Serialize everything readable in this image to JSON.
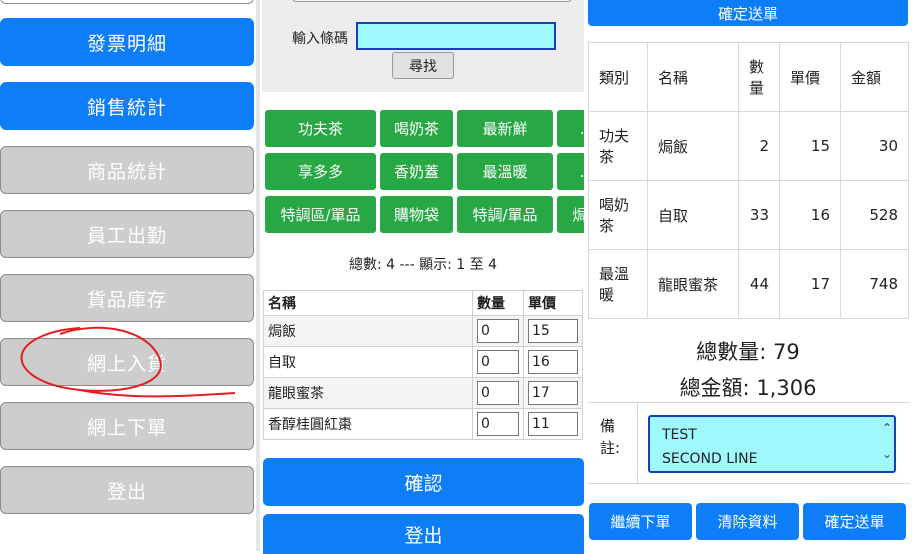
{
  "nav": {
    "items": [
      {
        "label": "發票明細",
        "active": true
      },
      {
        "label": "銷售統計",
        "active": true
      },
      {
        "label": "商品統計",
        "active": false
      },
      {
        "label": "員工出勤",
        "active": false
      },
      {
        "label": "貨品庫存",
        "active": false
      },
      {
        "label": "網上入貨",
        "active": false
      },
      {
        "label": "網上下單",
        "active": false
      },
      {
        "label": "登出",
        "active": false
      }
    ]
  },
  "search": {
    "label": "輸入條碼",
    "value": "",
    "button": "尋找"
  },
  "categories": [
    [
      "功夫茶",
      "喝奶茶",
      "最新鮮",
      "..."
    ],
    [
      "享多多",
      "香奶蓋",
      "最溫暖",
      "..."
    ],
    [
      "特調區/單品",
      "購物袋",
      "特調/單品",
      "焗..."
    ]
  ],
  "summary": "總數: 4 --- 顯示: 1 至 4",
  "product_table": {
    "headers": [
      "名稱",
      "數量",
      "單價"
    ],
    "rows": [
      {
        "name": "焗飯",
        "qty": "0",
        "price": "15"
      },
      {
        "name": "自取",
        "qty": "0",
        "price": "16"
      },
      {
        "name": "龍眼蜜茶",
        "qty": "0",
        "price": "17"
      },
      {
        "name": "香醇桂圓紅棗",
        "qty": "0",
        "price": "11"
      }
    ]
  },
  "buttons": {
    "confirm": "確認",
    "logout": "登出"
  },
  "order": {
    "top_button": "確定送單",
    "headers": {
      "category": "類別",
      "name": "名稱",
      "qty": "數量",
      "price": "單價",
      "amount": "金額"
    },
    "rows": [
      {
        "category": "功夫茶",
        "name": "焗飯",
        "qty": "2",
        "price": "15",
        "amount": "30"
      },
      {
        "category": "喝奶茶",
        "name": "自取",
        "qty": "33",
        "price": "16",
        "amount": "528"
      },
      {
        "category": "最溫暖",
        "name": "龍眼蜜茶",
        "qty": "44",
        "price": "17",
        "amount": "748"
      }
    ],
    "total_qty_label": "總數量: 79",
    "total_amount_label": "總金額: 1,306",
    "remark_label": "備註:",
    "remark_line1": "TEST",
    "remark_line2": "SECOND LINE",
    "continue_button": "繼續下單",
    "clear_button": "清除資料",
    "submit_button": "確定送單"
  },
  "colors": {
    "primary": "#0d7ef8",
    "category": "#27a844",
    "input_bg": "#9ff8fb",
    "disabled": "#cdcdcd"
  }
}
